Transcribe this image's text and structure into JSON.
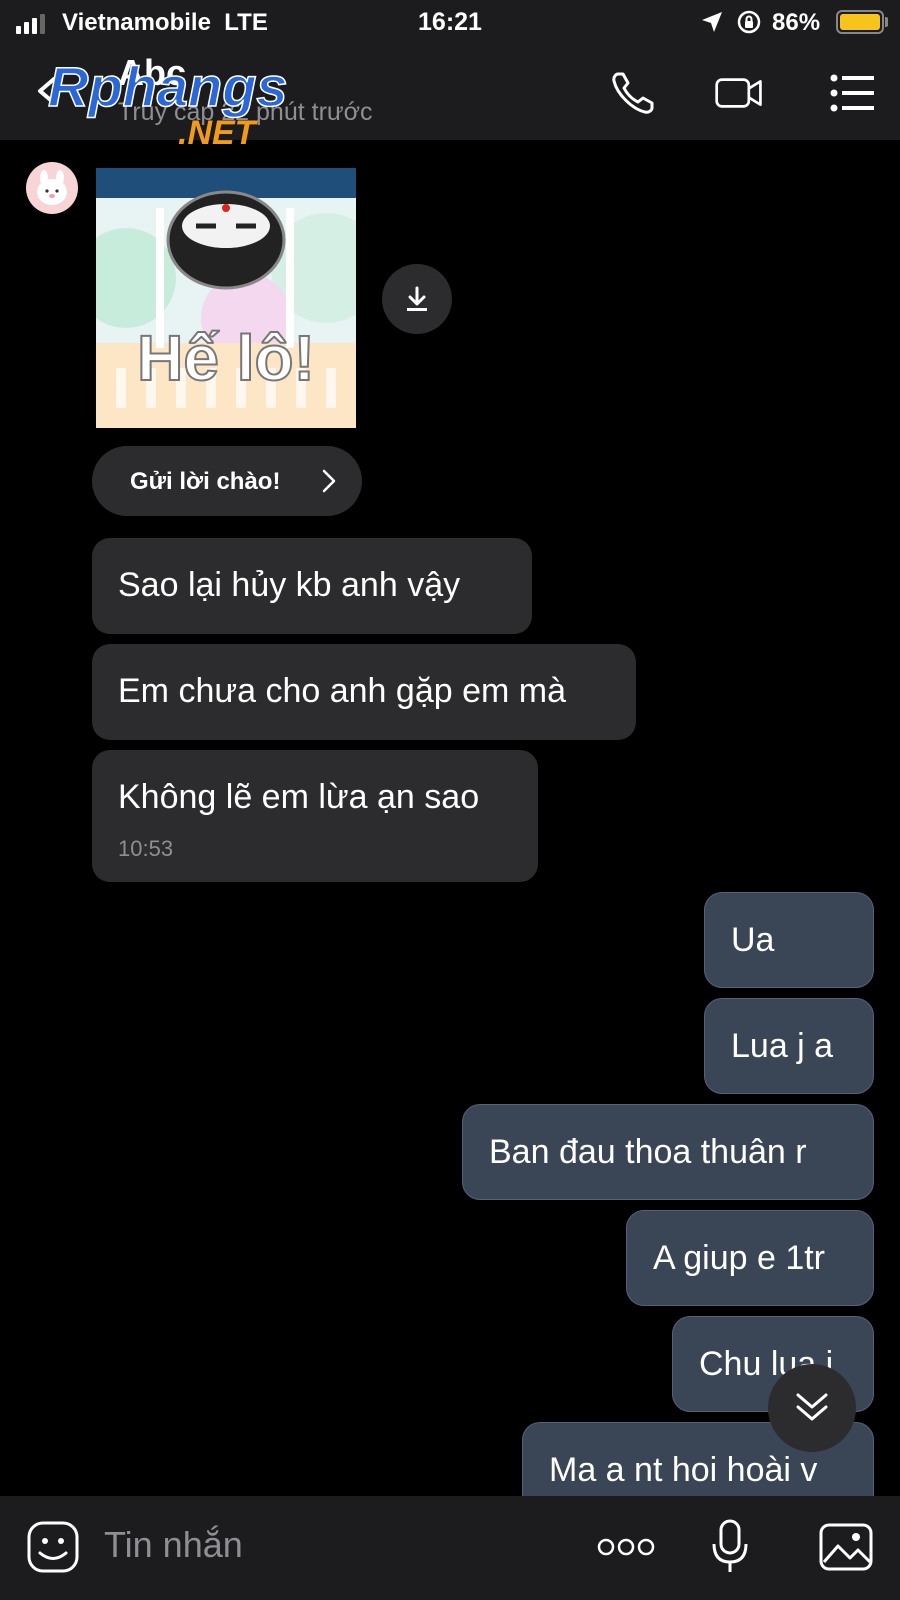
{
  "status_bar": {
    "carrier": "Vietnamobile",
    "network": "LTE",
    "time": "16:21",
    "battery": "86%",
    "battery_level": 0.86,
    "battery_color": "#f6c41b"
  },
  "header": {
    "contact_name": "Abc",
    "last_seen": "Truy cập 22 phút trước",
    "watermark_text": "Rphangs",
    "watermark_suffix": ".NET",
    "icons": [
      "back-icon",
      "phone-icon",
      "video-call-icon",
      "menu-icon"
    ]
  },
  "sticker": {
    "caption": "Hế lô!"
  },
  "greeting_button": {
    "label": "Gửi lời chào!"
  },
  "received_messages": [
    {
      "text": "Sao lại hủy kb anh vậy"
    },
    {
      "text": "Em chưa cho anh gặp em mà"
    },
    {
      "text": "Không lẽ em lừa ạn sao",
      "time": "10:53"
    }
  ],
  "sent_messages": [
    {
      "text": "Ua"
    },
    {
      "text": "Lua j a"
    },
    {
      "text": "Ban đau thoa thuân r"
    },
    {
      "text": "A giup e 1tr"
    },
    {
      "text": "Chu lua j"
    },
    {
      "text": "Ma a nt hoi hoài v"
    }
  ],
  "input_bar": {
    "placeholder": "Tin nhắn",
    "icons": [
      "emoji-icon",
      "more-icon",
      "mic-icon",
      "image-icon"
    ]
  },
  "colors": {
    "background": "#000000",
    "bar": "#1c1c1e",
    "received_bubble": "#2c2c2e",
    "sent_bubble": "#3a4556"
  }
}
